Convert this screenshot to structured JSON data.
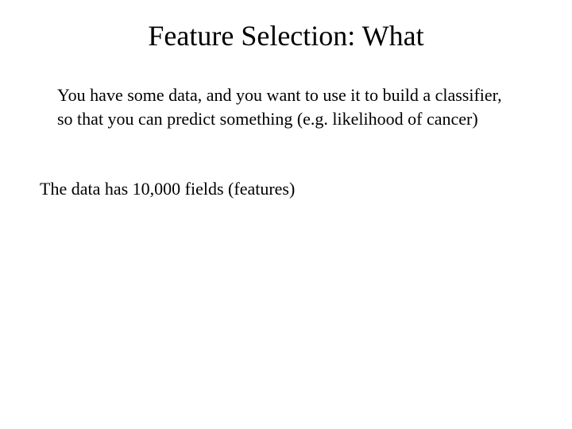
{
  "slide": {
    "title": "Feature Selection:  What",
    "para1": "You have some data, and you want to use it to build a classifier, so that you can predict something (e.g. likelihood of cancer)",
    "para2": "The data has 10,000 fields (features)"
  }
}
